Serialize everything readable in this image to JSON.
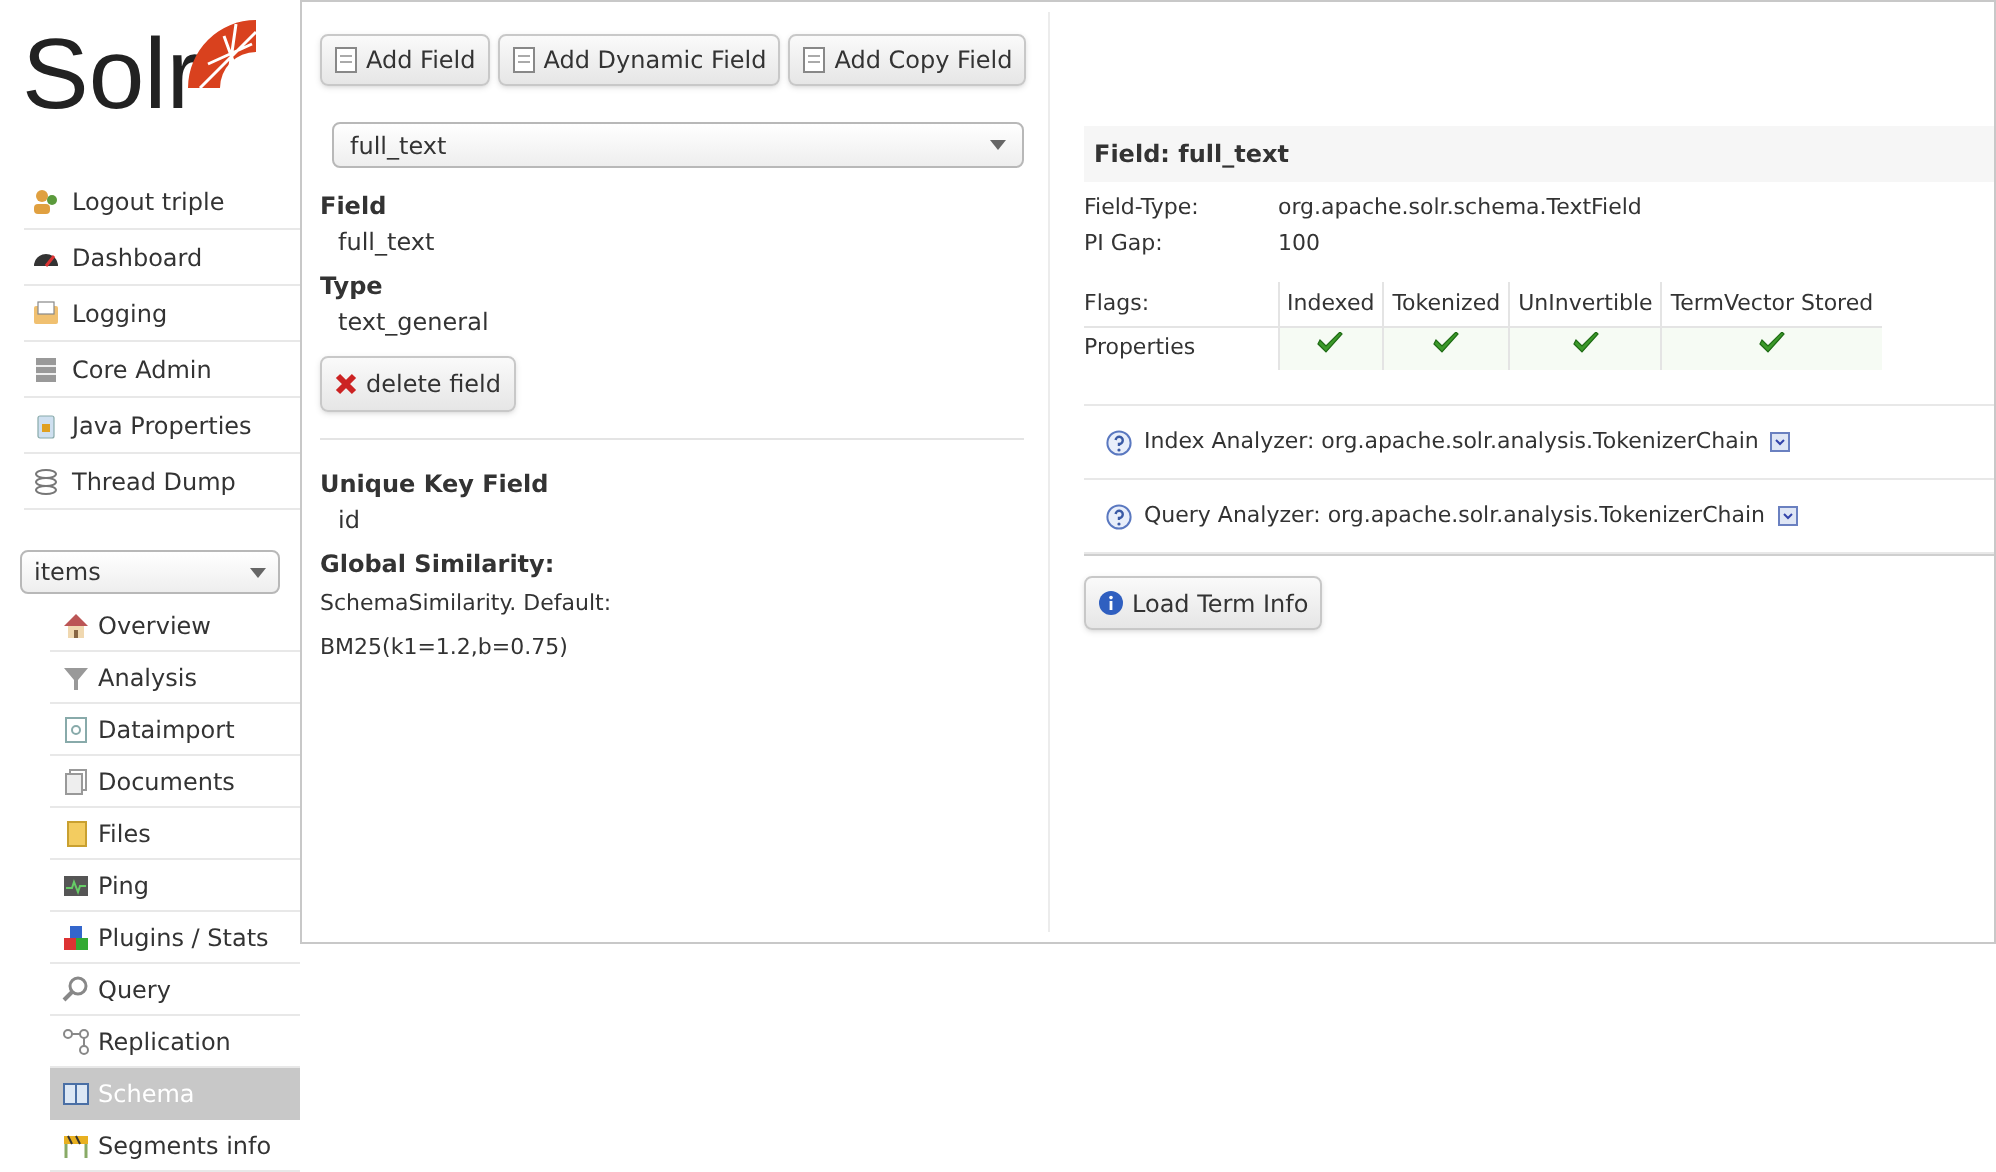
{
  "logo": {
    "text": "Solr"
  },
  "nav": [
    {
      "label": "Logout triple"
    },
    {
      "label": "Dashboard"
    },
    {
      "label": "Logging"
    },
    {
      "label": "Core Admin"
    },
    {
      "label": "Java Properties"
    },
    {
      "label": "Thread Dump"
    }
  ],
  "core_selector": {
    "value": "items"
  },
  "core_menu": [
    {
      "label": "Overview",
      "selected": false
    },
    {
      "label": "Analysis",
      "selected": false
    },
    {
      "label": "Dataimport",
      "selected": false
    },
    {
      "label": "Documents",
      "selected": false
    },
    {
      "label": "Files",
      "selected": false
    },
    {
      "label": "Ping",
      "selected": false
    },
    {
      "label": "Plugins / Stats",
      "selected": false
    },
    {
      "label": "Query",
      "selected": false
    },
    {
      "label": "Replication",
      "selected": false
    },
    {
      "label": "Schema",
      "selected": true
    },
    {
      "label": "Segments info",
      "selected": false
    }
  ],
  "toolbar": [
    "Add Field",
    "Add Dynamic Field",
    "Add Copy Field"
  ],
  "field_select": {
    "value": "full_text"
  },
  "field_info": [
    {
      "label": "Field",
      "value": "full_text"
    },
    {
      "label": "Type",
      "value": "text_general"
    }
  ],
  "delete_button": "delete field",
  "unique_key": {
    "label": "Unique Key Field",
    "value": "id"
  },
  "global_similarity": {
    "label": "Global Similarity:",
    "lines": [
      "SchemaSimilarity. Default:",
      "BM25(k1=1.2,b=0.75)"
    ]
  },
  "details": {
    "title": "Field: full_text",
    "properties": [
      {
        "label": "Field-Type:",
        "value": "org.apache.solr.schema.TextField"
      },
      {
        "label": "PI Gap:",
        "value": "100"
      }
    ],
    "flags": {
      "label": "Flags:",
      "columns": [
        "Indexed",
        "Tokenized",
        "UnInvertible",
        "TermVector Stored"
      ],
      "rows": [
        {
          "label": "Properties",
          "checks": [
            true,
            true,
            true,
            true
          ]
        }
      ]
    }
  },
  "analyzers": [
    {
      "label": "Index Analyzer:",
      "value": "org.apache.solr.analysis.TokenizerChain"
    },
    {
      "label": "Query Analyzer:",
      "value": "org.apache.solr.analysis.TokenizerChain"
    }
  ],
  "load_button": "Load Term Info"
}
